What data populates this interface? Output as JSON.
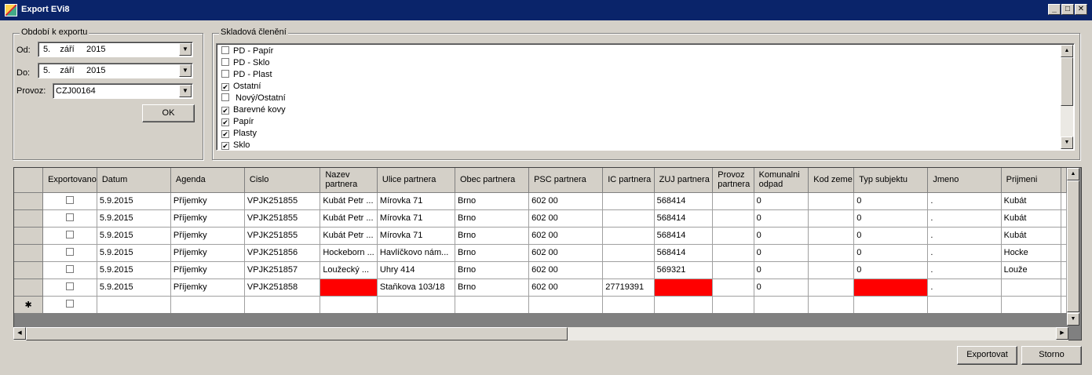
{
  "window": {
    "title": "Export EVi8",
    "minimize_glyph": "_",
    "maximize_glyph": "□",
    "close_glyph": "✕"
  },
  "period": {
    "legend": "Období k exportu",
    "from_label": "Od:",
    "from_value": "5.    září     2015",
    "to_label": "Do:",
    "to_value": "5.    září     2015",
    "provoz_label": "Provoz:",
    "provoz_value": "CZJ00164",
    "ok_label": "OK"
  },
  "warehouse": {
    "legend": "Skladová členění",
    "items": [
      {
        "label": "PD - Papír",
        "checked": false
      },
      {
        "label": "PD - Sklo",
        "checked": false
      },
      {
        "label": "PD - Plast",
        "checked": false
      },
      {
        "label": "Ostatní",
        "checked": true
      },
      {
        "label": " Nový/Ostatní",
        "checked": false
      },
      {
        "label": "Barevné kovy",
        "checked": true
      },
      {
        "label": "Papír",
        "checked": true
      },
      {
        "label": "Plasty",
        "checked": true
      },
      {
        "label": "Sklo",
        "checked": true
      }
    ]
  },
  "grid": {
    "columns": [
      "Exportovano",
      "Datum",
      "Agenda",
      "Cislo",
      "Nazev partnera",
      "Ulice partnera",
      "Obec partnera",
      "PSC partnera",
      "IC partnera",
      "ZUJ partnera",
      "Provoz partnera",
      "Komunalni odpad",
      "Kod zeme",
      "Typ subjektu",
      "Jmeno",
      "Prijmeni"
    ],
    "rows": [
      {
        "cells": [
          "",
          "5.9.2015",
          "Příjemky",
          "VPJK251855",
          "Kubát Petr ...",
          "Mírovka 71",
          "Brno",
          "602 00",
          "",
          "568414",
          "",
          "0",
          "",
          "0",
          ".",
          "Kubát"
        ],
        "errors": []
      },
      {
        "cells": [
          "",
          "5.9.2015",
          "Příjemky",
          "VPJK251855",
          "Kubát Petr ...",
          "Mírovka 71",
          "Brno",
          "602 00",
          "",
          "568414",
          "",
          "0",
          "",
          "0",
          ".",
          "Kubát"
        ],
        "errors": []
      },
      {
        "cells": [
          "",
          "5.9.2015",
          "Příjemky",
          "VPJK251855",
          "Kubát Petr ...",
          "Mírovka 71",
          "Brno",
          "602 00",
          "",
          "568414",
          "",
          "0",
          "",
          "0",
          ".",
          "Kubát"
        ],
        "errors": []
      },
      {
        "cells": [
          "",
          "5.9.2015",
          "Příjemky",
          "VPJK251856",
          "Hockeborn ...",
          "Havlíčkovo nám...",
          "Brno",
          "602 00",
          "",
          "568414",
          "",
          "0",
          "",
          "0",
          ".",
          "Hocke"
        ],
        "errors": []
      },
      {
        "cells": [
          "",
          "5.9.2015",
          "Příjemky",
          "VPJK251857",
          "Loužecký ...",
          "Uhry 414",
          "Brno",
          "602 00",
          "",
          "569321",
          "",
          "0",
          "",
          "0",
          ".",
          "Louže"
        ],
        "errors": []
      },
      {
        "cells": [
          "",
          "5.9.2015",
          "Příjemky",
          "VPJK251858",
          "",
          "Staňkova 103/18",
          "Brno",
          "602 00",
          "27719391",
          "",
          "",
          "0",
          "",
          "",
          ".",
          ""
        ],
        "errors": [
          4,
          9,
          13
        ]
      }
    ],
    "new_row_marker": "✱"
  },
  "footer": {
    "export_label": "Exportovat",
    "cancel_label": "Storno"
  },
  "colors": {
    "titlebar": "#0a246a",
    "window_bg": "#d4d0c8",
    "error_cell": "#ff0000"
  },
  "icons": {
    "app": "app-icon",
    "dropdown": "chevron-down-icon",
    "checkbox": "checkbox-icon",
    "scroll_up": "arrow-up-icon",
    "scroll_down": "arrow-down-icon",
    "scroll_left": "arrow-left-icon",
    "scroll_right": "arrow-right-icon"
  }
}
